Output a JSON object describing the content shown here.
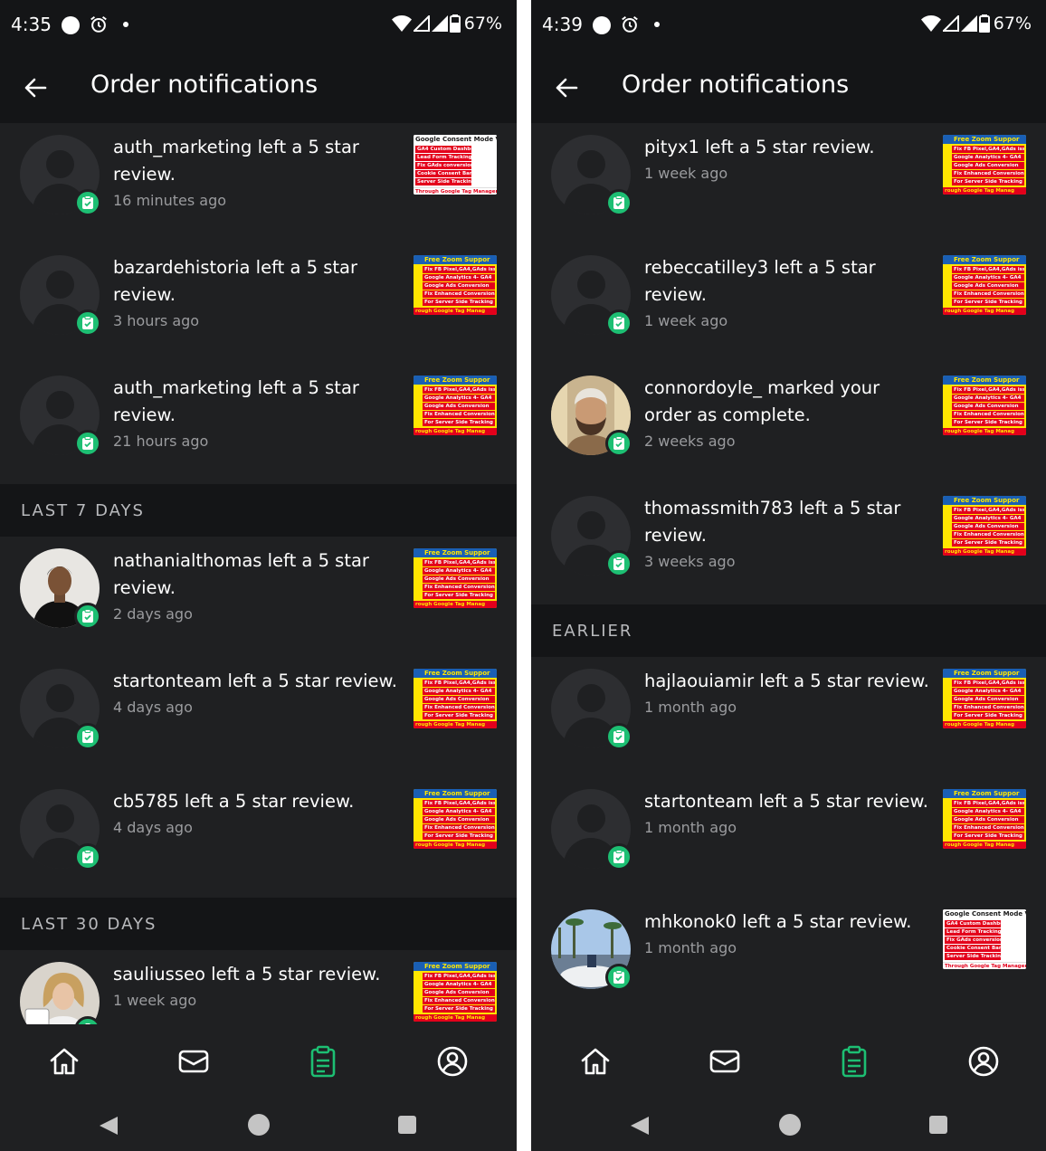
{
  "colors": {
    "background": "#1f2022",
    "header": "#141517",
    "accent_green": "#1dbf73",
    "muted_text": "#9a9b9e"
  },
  "thumbnails": {
    "zoom": {
      "header": "Free Zoom Suppor",
      "rows": [
        "Fix FB Pixel,GA4,GAds issue",
        "Google Analytics 4- GA4",
        "Google Ads Conversion",
        "Fix Enhanced Conversion",
        "For Server Side Tracking"
      ],
      "footer": "rough Google Tag Manag"
    },
    "consent": {
      "header": "Google Consent Mode V2",
      "rows": [
        "GA4 Custom Dashboard",
        "Lead Form Tracking",
        "Fix GAds conversion issue",
        "Cookie Consent Banner",
        "Server Side Tracking"
      ],
      "footer": "Through Google Tag Manager"
    }
  },
  "left": {
    "status": {
      "time": "4:35",
      "battery": "67%"
    },
    "title": "Order notifications",
    "items": [
      {
        "message": "auth_marketing left a 5 star review.",
        "time": "16 minutes ago",
        "avatar": "placeholder",
        "thumb": "consent"
      },
      {
        "message": "bazardehistoria left a 5 star review.",
        "time": "3 hours ago",
        "avatar": "placeholder",
        "thumb": "zoom"
      },
      {
        "message": "auth_marketing left a 5 star review.",
        "time": "21 hours ago",
        "avatar": "placeholder",
        "thumb": "zoom"
      }
    ],
    "section1": "LAST 7 DAYS",
    "items2": [
      {
        "message": "nathanialthomas left a 5 star review.",
        "time": "2 days ago",
        "avatar": "photo-man-dark",
        "thumb": "zoom"
      },
      {
        "message": "startonteam left a 5 star review.",
        "time": "4 days ago",
        "avatar": "placeholder",
        "thumb": "zoom"
      },
      {
        "message": "cb5785 left a 5 star review.",
        "time": "4 days ago",
        "avatar": "placeholder",
        "thumb": "zoom"
      }
    ],
    "section2": "LAST 30 DAYS",
    "items3": [
      {
        "message": "sauliusseo left a 5 star review.",
        "time": "1 week ago",
        "avatar": "photo-woman",
        "thumb": "zoom"
      }
    ]
  },
  "right": {
    "status": {
      "time": "4:39",
      "battery": "67%"
    },
    "title": "Order notifications",
    "items": [
      {
        "message": "pityx1 left a 5 star review.",
        "time": "1 week ago",
        "avatar": "placeholder",
        "thumb": "zoom"
      },
      {
        "message": "rebeccatilley3 left a 5 star review.",
        "time": "1 week ago",
        "avatar": "placeholder",
        "thumb": "zoom"
      },
      {
        "message": "connordoyle_ marked your order as complete.",
        "time": "2 weeks ago",
        "avatar": "photo-man-beard",
        "thumb": "zoom"
      },
      {
        "message": "thomassmith783 left a 5 star review.",
        "time": "3 weeks ago",
        "avatar": "placeholder",
        "thumb": "zoom"
      }
    ],
    "section1": "EARLIER",
    "items2": [
      {
        "message": "hajlaouiamir left a 5 star review.",
        "time": "1 month ago",
        "avatar": "placeholder",
        "thumb": "zoom"
      },
      {
        "message": "startonteam left a 5 star review.",
        "time": "1 month ago",
        "avatar": "placeholder",
        "thumb": "zoom"
      },
      {
        "message": "mhkonok0 left a 5 star review.",
        "time": "1 month ago",
        "avatar": "photo-landscape",
        "thumb": "consent"
      }
    ]
  },
  "bottom_nav": [
    "home-icon",
    "inbox-icon",
    "orders-icon",
    "profile-icon"
  ],
  "active_nav": "orders-icon"
}
